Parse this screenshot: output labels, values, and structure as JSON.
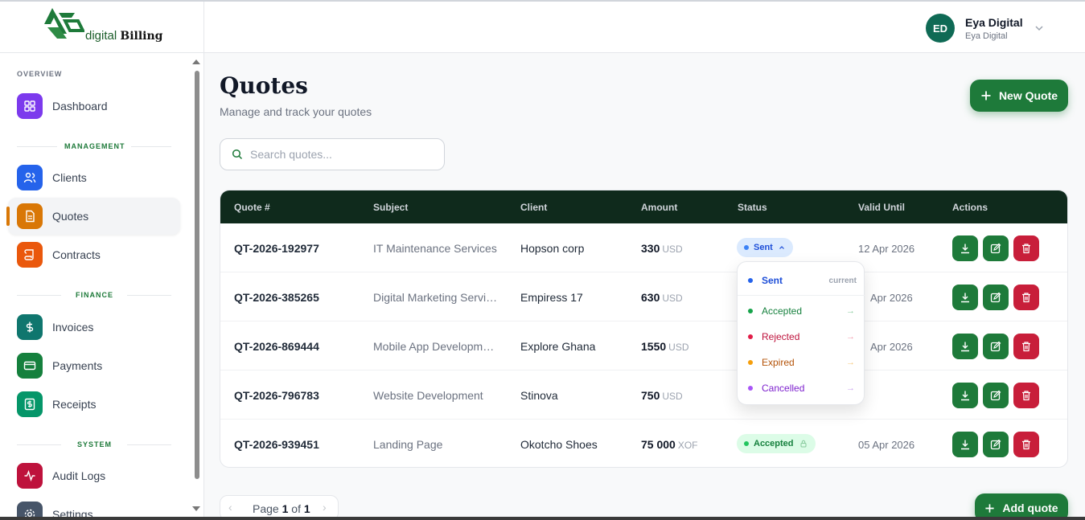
{
  "brand": {
    "name_light": "digital",
    "name_bold": "Billing",
    "color": "#1e7a3a"
  },
  "user": {
    "initials": "ED",
    "name": "Eya Digital",
    "org": "Eya Digital"
  },
  "sidebar": {
    "sections": [
      {
        "label": "OVERVIEW",
        "color": "#6b7280"
      },
      {
        "label": "MANAGEMENT",
        "color": "#1e7a3a"
      },
      {
        "label": "FINANCE",
        "color": "#1e7a3a"
      },
      {
        "label": "SYSTEM",
        "color": "#1e7a3a"
      }
    ],
    "items": [
      {
        "label": "Dashboard",
        "icon": "grid-icon",
        "color": "#7c3aed"
      },
      {
        "label": "Clients",
        "icon": "users-icon",
        "color": "#2563eb"
      },
      {
        "label": "Quotes",
        "icon": "document-icon",
        "color": "#d97706",
        "active": true
      },
      {
        "label": "Contracts",
        "icon": "scroll-icon",
        "color": "#ea580c"
      },
      {
        "label": "Invoices",
        "icon": "dollar-icon",
        "color": "#0f766e"
      },
      {
        "label": "Payments",
        "icon": "card-icon",
        "color": "#15803d"
      },
      {
        "label": "Receipts",
        "icon": "receipt-icon",
        "color": "#059669"
      },
      {
        "label": "Audit Logs",
        "icon": "activity-icon",
        "color": "#be123c"
      },
      {
        "label": "Settings",
        "icon": "gear-icon",
        "color": "#475569"
      }
    ]
  },
  "page": {
    "title": "Quotes",
    "subtitle": "Manage and track your quotes",
    "new_button": "New Quote",
    "add_button": "Add quote",
    "search_placeholder": "Search quotes..."
  },
  "table": {
    "columns": [
      "Quote #",
      "Subject",
      "Client",
      "Amount",
      "Status",
      "Valid Until",
      "Actions"
    ],
    "rows": [
      {
        "quote": "QT-2026-192977",
        "subject": "IT Maintenance Services",
        "client": "Hopson corp",
        "amount": "330",
        "currency": "USD",
        "status": "Sent",
        "valid": "12 Apr 2026"
      },
      {
        "quote": "QT-2026-385265",
        "subject": "Digital Marketing Services",
        "client": "Empiress 17",
        "amount": "630",
        "currency": "USD",
        "status": "",
        "valid": "Apr 2026"
      },
      {
        "quote": "QT-2026-869444",
        "subject": "Mobile App Development",
        "client": "Explore Ghana",
        "amount": "1550",
        "currency": "USD",
        "status": "",
        "valid": "Apr 2026"
      },
      {
        "quote": "QT-2026-796783",
        "subject": "Website Development",
        "client": "Stinova",
        "amount": "750",
        "currency": "USD",
        "status": "",
        "valid": ""
      },
      {
        "quote": "QT-2026-939451",
        "subject": "Landing Page",
        "client": "Okotcho Shoes",
        "amount": "75 000",
        "currency": "XOF",
        "status": "Accepted",
        "valid": "05 Apr 2026"
      }
    ]
  },
  "status_menu": {
    "current_label": "current",
    "options": [
      {
        "label": "Sent",
        "color": "#2563eb",
        "current": true
      },
      {
        "label": "Accepted",
        "color": "#16a34a"
      },
      {
        "label": "Rejected",
        "color": "#be123c"
      },
      {
        "label": "Expired",
        "color": "#d97706"
      },
      {
        "label": "Cancelled",
        "color": "#9333ea"
      }
    ]
  },
  "pagination": {
    "prefix": "Page",
    "current": "1",
    "of": "of",
    "total": "1"
  }
}
